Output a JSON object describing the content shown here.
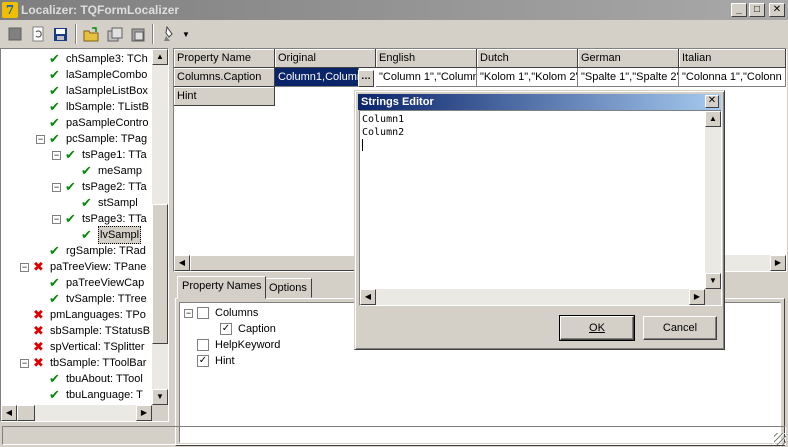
{
  "window": {
    "title": "Localizer: TQFormLocalizer",
    "controls": {
      "minimize": "_",
      "maximize": "□",
      "close": "✕"
    }
  },
  "toolbar": {
    "buttons": [
      "stop-icon",
      "refresh-doc-icon",
      "save-icon",
      "open-folder-icon",
      "copy-icon",
      "paste-icon",
      "paint-icon"
    ],
    "dropdown_arrow": "▼"
  },
  "tree": {
    "rows": [
      {
        "status": "ok",
        "label": "chSample3: TCh"
      },
      {
        "status": "ok",
        "label": "laSampleCombo"
      },
      {
        "status": "ok",
        "label": "laSampleListBox"
      },
      {
        "status": "ok",
        "label": "lbSample: TListB"
      },
      {
        "status": "ok",
        "label": "paSampleContro"
      },
      {
        "status": "ok",
        "label": "pcSample: TPag",
        "expander": "−"
      },
      {
        "status": "ok",
        "label": "tsPage1: TTa",
        "expander": "−"
      },
      {
        "status": "ok",
        "label": "meSamp"
      },
      {
        "status": "ok",
        "label": "tsPage2: TTa",
        "expander": "−"
      },
      {
        "status": "ok",
        "label": "stSampl"
      },
      {
        "status": "ok",
        "label": "tsPage3: TTa",
        "expander": "−"
      },
      {
        "status": "ok",
        "label": "lvSampl",
        "selected": true
      },
      {
        "status": "ok",
        "label": "rgSample: TRad"
      },
      {
        "status": "x",
        "label": "paTreeView: TPane",
        "expander": "−"
      },
      {
        "status": "ok",
        "label": "paTreeViewCap"
      },
      {
        "status": "ok",
        "label": "tvSample: TTree"
      },
      {
        "status": "x",
        "label": "pmLanguages: TPo"
      },
      {
        "status": "x",
        "label": "sbSample: TStatusB"
      },
      {
        "status": "x",
        "label": "spVertical: TSplitter"
      },
      {
        "status": "x",
        "label": "tbSample: TToolBar",
        "expander": "−"
      },
      {
        "status": "ok",
        "label": "tbuAbout: TTool"
      },
      {
        "status": "ok",
        "label": "tbuLanguage: T"
      }
    ]
  },
  "grid": {
    "headers": [
      "Property Name",
      "Original",
      "English",
      "Dutch",
      "German",
      "Italian"
    ],
    "rows": [
      {
        "name": "Columns.Caption",
        "original": "Column1,Column",
        "english": "\"Column 1\",\"Column",
        "dutch": "\"Kolom 1\",\"Kolom 2\"",
        "german": "\"Spalte 1\",\"Spalte 2\"",
        "italian": "\"Colonna 1\",\"Colonn"
      },
      {
        "name": "Hint",
        "original": "",
        "english": "",
        "dutch": "",
        "german": "",
        "italian": ""
      }
    ],
    "ellipsis": "…"
  },
  "tabs": {
    "items": [
      "Property Names",
      "Options"
    ],
    "active": 0,
    "property_tree": [
      {
        "label": "Columns",
        "checked": false,
        "expander": "−",
        "level": 0
      },
      {
        "label": "Caption",
        "checked": true,
        "level": 1
      },
      {
        "label": "HelpKeyword",
        "checked": false,
        "level": 0
      },
      {
        "label": "Hint",
        "checked": true,
        "level": 0
      }
    ]
  },
  "dialog": {
    "title": "Strings Editor",
    "close": "✕",
    "lines": [
      "Column1",
      "Column2"
    ],
    "ok_label": "OK",
    "cancel_label": "Cancel"
  },
  "colors": {
    "highlight": "#0a246a",
    "ok_mark": "#0a8a0a",
    "x_mark": "#e00000",
    "face": "#d4d0c8"
  }
}
